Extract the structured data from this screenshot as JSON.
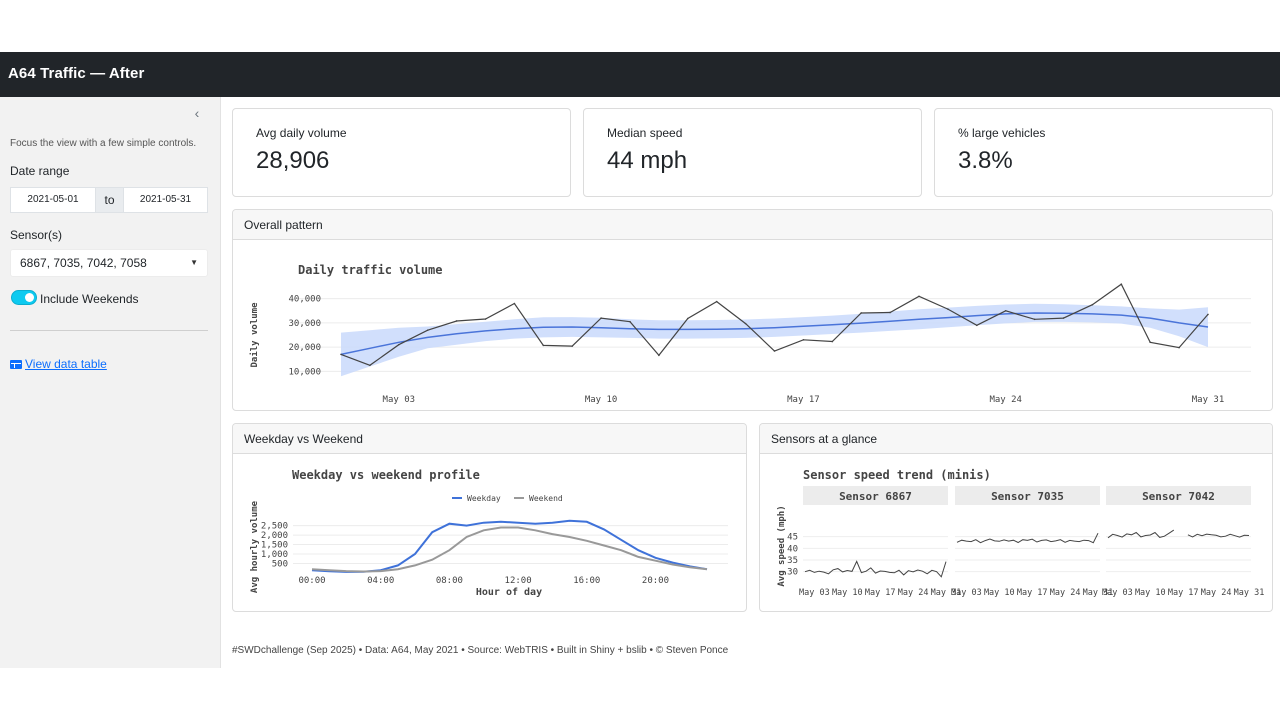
{
  "app": {
    "title": "A64 Traffic — After"
  },
  "sidebar": {
    "collapse_icon": "chevron-left-icon",
    "note": "Focus the view with a few simple controls.",
    "date_range_label": "Date range",
    "date_start": "2021-05-01",
    "date_to": "to",
    "date_end": "2021-05-31",
    "sensors_label": "Sensor(s)",
    "sensors_value": "6867, 7035, 7042, 7058",
    "include_weekends_label": "Include Weekends",
    "include_weekends_on": true,
    "data_table_link": "View data table"
  },
  "kpis": [
    {
      "label": "Avg daily volume",
      "value": "28,906"
    },
    {
      "label": "Median speed",
      "value": "44 mph"
    },
    {
      "label": "% large vehicles",
      "value": "3.8%"
    }
  ],
  "cards": {
    "overall": "Overall pattern",
    "weekday": "Weekday vs Weekend",
    "sensors": "Sensors at a glance"
  },
  "footer": "#SWDchallenge (Sep 2025) • Data: A64, May 2021 • Source: WebTRIS • Built in Shiny + bslib • © Steven Ponce",
  "chart_data": [
    {
      "type": "line",
      "title": "Daily traffic volume",
      "xlabel": "",
      "ylabel": "Daily volume",
      "ylim": [
        6000,
        44000
      ],
      "y_ticks": [
        10000,
        20000,
        30000,
        40000
      ],
      "y_tick_labels": [
        "10,000",
        "20,000",
        "30,000",
        "40,000"
      ],
      "x_tick_days": [
        3,
        10,
        17,
        24,
        31
      ],
      "x_tick_labels": [
        "May 03",
        "May 10",
        "May 17",
        "May 24",
        "May 31"
      ],
      "colors": {
        "line": "#444444",
        "trend": "#4a74d9",
        "band": "#c9d9fb"
      },
      "x": [
        1,
        2,
        3,
        4,
        5,
        6,
        7,
        8,
        9,
        10,
        11,
        12,
        13,
        14,
        15,
        16,
        17,
        18,
        19,
        20,
        21,
        22,
        23,
        24,
        25,
        26,
        27,
        28,
        29,
        30,
        31
      ],
      "values": [
        17000,
        12500,
        21000,
        27000,
        30800,
        31600,
        38000,
        20700,
        20400,
        32000,
        30500,
        16600,
        31800,
        38800,
        29700,
        18400,
        23000,
        22300,
        34100,
        34300,
        41000,
        35700,
        29000,
        35000,
        31500,
        32000,
        37500,
        46000,
        22000,
        19800,
        33500
      ],
      "trend": [
        17000,
        19500,
        22000,
        24000,
        25500,
        26700,
        27600,
        28200,
        28300,
        28000,
        27600,
        27300,
        27300,
        27400,
        27600,
        28000,
        28600,
        29200,
        29900,
        30700,
        31500,
        32200,
        33000,
        33700,
        34100,
        34000,
        33700,
        33200,
        32000,
        30000,
        28300
      ],
      "band_low": [
        8000,
        12000,
        16000,
        19500,
        21000,
        22500,
        23500,
        24000,
        24200,
        24000,
        23800,
        23500,
        23500,
        23600,
        23800,
        24200,
        24800,
        25400,
        26000,
        26700,
        27400,
        28200,
        29000,
        29800,
        30400,
        30400,
        30200,
        29700,
        28000,
        24500,
        20000
      ],
      "band_high": [
        26000,
        27000,
        28000,
        28500,
        29500,
        30500,
        31500,
        32300,
        32400,
        32100,
        31500,
        31100,
        31100,
        31200,
        31400,
        31800,
        32400,
        33000,
        33800,
        34700,
        35600,
        36300,
        37000,
        37600,
        37900,
        37700,
        37300,
        36800,
        36000,
        35500,
        36500
      ]
    },
    {
      "type": "line",
      "title": "Weekday vs weekend profile",
      "xlabel": "Hour of day",
      "ylabel": "Avg hourly volume",
      "ylim": [
        0,
        2900
      ],
      "y_ticks": [
        500,
        1000,
        1500,
        2000,
        2500
      ],
      "y_tick_labels": [
        "500",
        "1,000",
        "1,500",
        "2,000",
        "2,500"
      ],
      "x_ticks": [
        0,
        4,
        8,
        12,
        16,
        20
      ],
      "x_tick_labels": [
        "00:00",
        "04:00",
        "08:00",
        "12:00",
        "16:00",
        "20:00"
      ],
      "legend": "top",
      "x": [
        0,
        1,
        2,
        3,
        4,
        5,
        6,
        7,
        8,
        9,
        10,
        11,
        12,
        13,
        14,
        15,
        16,
        17,
        18,
        19,
        20,
        21,
        22,
        23
      ],
      "series": [
        {
          "name": "Weekday",
          "color": "#3f72d9",
          "values": [
            150,
            90,
            60,
            70,
            150,
            400,
            1000,
            2150,
            2600,
            2500,
            2650,
            2700,
            2650,
            2600,
            2650,
            2750,
            2700,
            2300,
            1750,
            1200,
            800,
            550,
            350,
            200
          ]
        },
        {
          "name": "Weekend",
          "color": "#999999",
          "values": [
            200,
            150,
            100,
            80,
            100,
            200,
            400,
            700,
            1200,
            1900,
            2250,
            2400,
            2400,
            2250,
            2050,
            1900,
            1700,
            1450,
            1200,
            850,
            650,
            450,
            300,
            200
          ]
        }
      ]
    },
    {
      "type": "line",
      "title": "Sensor speed trend (minis)",
      "ylabel": "Avg speed (mph)",
      "ylim": [
        26,
        50
      ],
      "y_ticks": [
        30,
        35,
        40,
        45
      ],
      "y_tick_labels": [
        "30",
        "35",
        "40",
        "45"
      ],
      "x_tick_days": [
        3,
        10,
        17,
        24,
        31
      ],
      "x_tick_labels": [
        "May 03",
        "May 10",
        "May 17",
        "May 24",
        "May 31"
      ],
      "panels": [
        {
          "name": "Sensor 6867",
          "x": [
            1,
            2,
            3,
            4,
            5,
            6,
            7,
            8,
            9,
            10,
            11,
            12,
            13,
            14,
            15,
            16,
            17,
            18,
            19,
            20,
            21,
            22,
            23,
            24,
            25,
            26,
            27,
            28,
            29,
            30,
            31
          ],
          "values": [
            30,
            30.6,
            29.7,
            30.2,
            29.8,
            29.1,
            30.8,
            31.3,
            29.9,
            30.5,
            30.1,
            34.4,
            29.6,
            30.2,
            31.6,
            29.4,
            30.3,
            30.1,
            29.7,
            29.5,
            30.6,
            28.6,
            30.4,
            29.9,
            30.7,
            30.2,
            29.1,
            30.6,
            30.0,
            27.8,
            34.3
          ]
        },
        {
          "name": "Sensor 7035",
          "x": [
            1,
            2,
            3,
            4,
            5,
            6,
            7,
            8,
            9,
            10,
            11,
            12,
            13,
            14,
            15,
            16,
            17,
            18,
            19,
            20,
            21,
            22,
            23,
            24,
            25,
            26,
            27,
            28,
            29,
            30,
            31
          ],
          "values": [
            42.6,
            43.5,
            43.1,
            42.9,
            43.7,
            42.4,
            43.3,
            44.0,
            43.2,
            43.0,
            43.6,
            43.1,
            43.5,
            42.5,
            43.7,
            43.4,
            43.9,
            42.7,
            43.4,
            43.6,
            42.9,
            43.2,
            43.7,
            42.6,
            43.4,
            43.1,
            42.9,
            43.5,
            43.3,
            42.4,
            46.5
          ]
        },
        {
          "name": "Sensor 7042",
          "x": [
            1,
            2,
            3,
            4,
            5,
            6,
            7,
            8,
            9,
            10,
            11,
            12,
            13,
            14,
            15,
            16,
            17,
            18,
            19,
            20,
            21,
            22,
            23,
            24,
            25,
            26,
            27,
            28,
            29,
            30,
            31
          ],
          "values": [
            44.5,
            46.0,
            45.5,
            44.8,
            46.2,
            45.8,
            46.8,
            44.9,
            45.5,
            45.7,
            46.8,
            44.7,
            45.2,
            46.5,
            47.8,
            null,
            null,
            45.8,
            44.9,
            46.0,
            45.4,
            46.1,
            45.8,
            45.6,
            44.9,
            45.2,
            46.0,
            45.4,
            44.8,
            45.6,
            45.5
          ]
        }
      ]
    }
  ]
}
